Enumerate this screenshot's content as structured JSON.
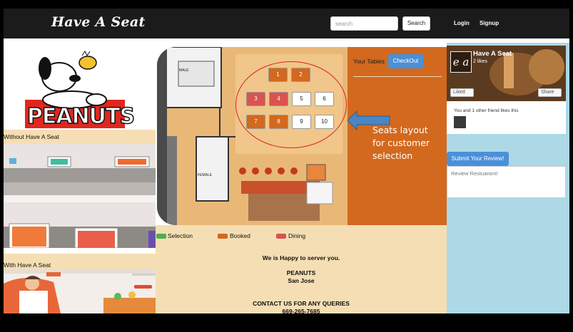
{
  "brand": {
    "name": "Have A Seat"
  },
  "nav": {
    "search_placeholder": "search",
    "search_label": "Search",
    "login_label": "Login",
    "signup_label": "Signup"
  },
  "left": {
    "logo_text": "PEANUTS",
    "without_label": "Without Have A Seat",
    "with_label": "With Have A Seat"
  },
  "seating": {
    "panel_title": "Your Tables",
    "checkout_label": "CheckOut",
    "annotation": "Seats layout for customer selection",
    "tables": [
      {
        "number": "1",
        "status": "booked"
      },
      {
        "number": "2",
        "status": "booked"
      },
      {
        "number": "3",
        "status": "dining"
      },
      {
        "number": "4",
        "status": "dining"
      },
      {
        "number": "5",
        "status": "available"
      },
      {
        "number": "6",
        "status": "available"
      },
      {
        "number": "7",
        "status": "booked"
      },
      {
        "number": "8",
        "status": "booked"
      },
      {
        "number": "9",
        "status": "available"
      },
      {
        "number": "10",
        "status": "available"
      }
    ],
    "floor_labels": {
      "male": "MALE",
      "female": "FEMALE"
    }
  },
  "legend": [
    {
      "label": "Selection",
      "color": "#4caf50"
    },
    {
      "label": "Booked",
      "color": "#d2691e"
    },
    {
      "label": "Dining",
      "color": "#d9534f"
    }
  ],
  "info": {
    "happy": "We is Happy to server you.",
    "restaurant": "PEANUTS",
    "city": "San Jose",
    "contact": "CONTACT US FOR ANY QUERIES",
    "phone": "669-265-7685"
  },
  "facebook": {
    "page_name": "Have A Seat",
    "likes": "2 likes",
    "logo_letters": "e a",
    "like_label": "Liked",
    "share_label": "Share",
    "friend_text": "You and 1 other friend likes this"
  },
  "review": {
    "submit_label": "Submit Your Review!",
    "placeholder": "Review Restuarant!"
  },
  "colors": {
    "booked": "#d2691e",
    "dining": "#d9534f",
    "available": "#ffffff",
    "accent": "#4a90d9",
    "panel": "#f5deb3"
  }
}
